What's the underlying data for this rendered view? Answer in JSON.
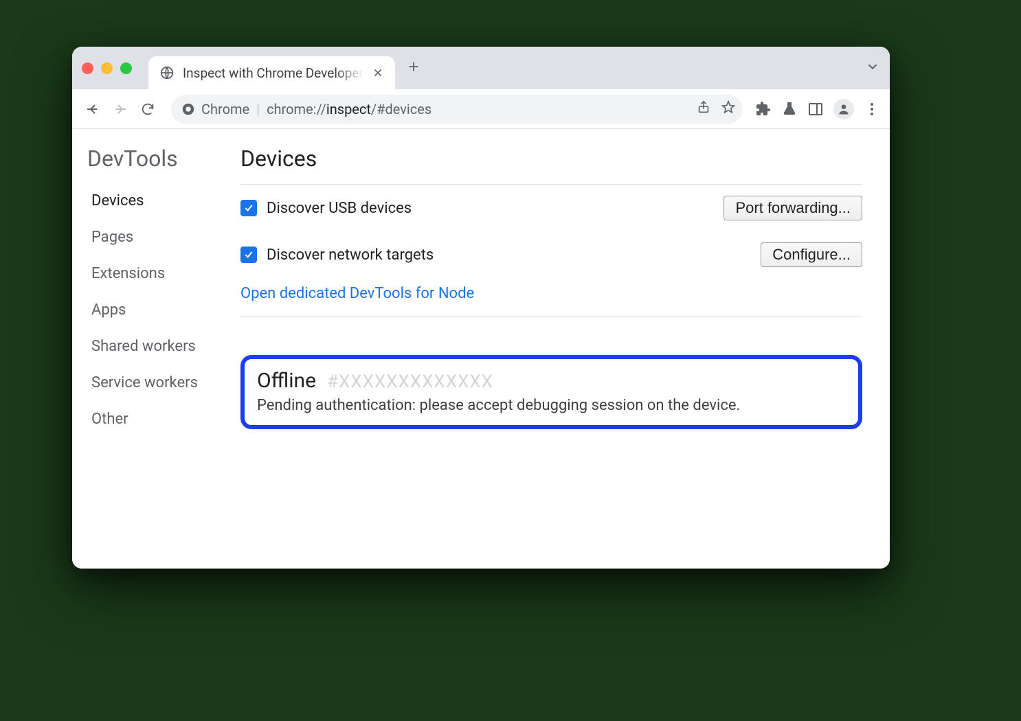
{
  "tab": {
    "title": "Inspect with Chrome Developer"
  },
  "omnibox": {
    "label": "Chrome",
    "url_dim_prefix": "chrome://",
    "url_bold": "inspect",
    "url_dim_suffix": "/#devices"
  },
  "sidebar": {
    "title": "DevTools",
    "items": [
      {
        "label": "Devices",
        "active": true
      },
      {
        "label": "Pages"
      },
      {
        "label": "Extensions"
      },
      {
        "label": "Apps"
      },
      {
        "label": "Shared workers"
      },
      {
        "label": "Service workers"
      },
      {
        "label": "Other"
      }
    ]
  },
  "main": {
    "heading": "Devices",
    "usb": {
      "label": "Discover USB devices",
      "button": "Port forwarding..."
    },
    "net": {
      "label": "Discover network targets",
      "button": "Configure..."
    },
    "node_link": "Open dedicated DevTools for Node",
    "device": {
      "status": "Offline",
      "hash": "#XXXXXXXXXXXXX",
      "message": "Pending authentication: please accept debugging session on the device."
    }
  }
}
